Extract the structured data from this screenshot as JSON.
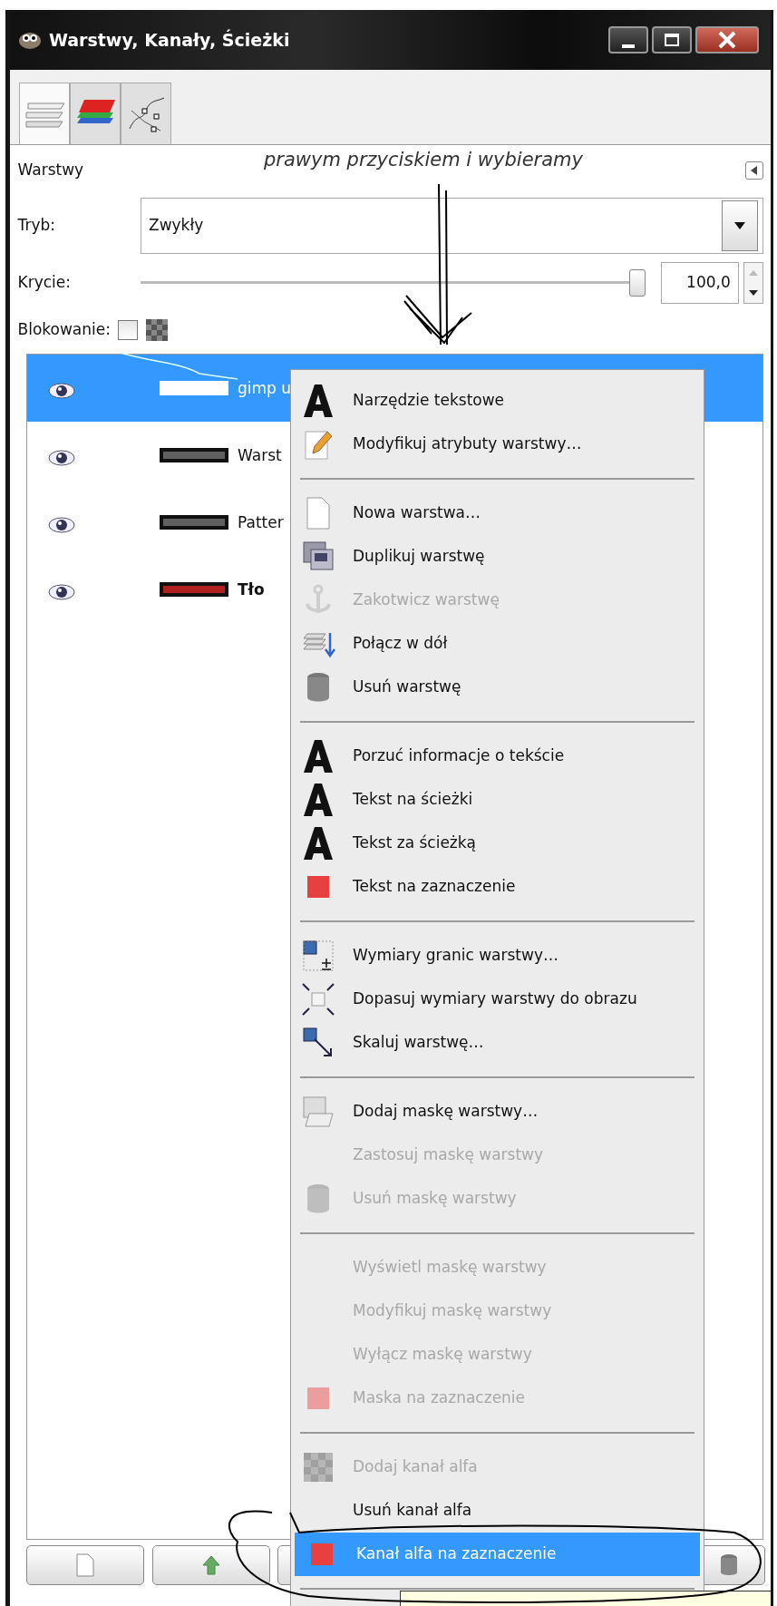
{
  "window": {
    "title": "Warstwy, Kanały, Ścieżki"
  },
  "tabs": [
    {
      "kind": "layers",
      "selected": true
    },
    {
      "kind": "channels",
      "selected": false
    },
    {
      "kind": "paths",
      "selected": false
    }
  ],
  "annotation": "prawym przyciskiem i wybieramy",
  "panel": {
    "title": "Warstwy",
    "mode": {
      "label": "Tryb:",
      "value": "Zwykły"
    },
    "opacity": {
      "label": "Krycie:",
      "level": 1,
      "reading": "100,0"
    },
    "lock": {
      "label": "Blokowanie:",
      "checked": false
    }
  },
  "layers": [
    {
      "name": "gimp u",
      "visible": true,
      "selected": true,
      "bold": false,
      "color": "#ffffff"
    },
    {
      "name": "Warst",
      "visible": true,
      "selected": false,
      "bold": false,
      "color": "#606060"
    },
    {
      "name": "Patter",
      "visible": true,
      "selected": false,
      "bold": false,
      "color": "#606060"
    },
    {
      "name": "Tło",
      "visible": true,
      "selected": false,
      "bold": true,
      "color": "#b02020"
    }
  ],
  "bottom_buttons": [
    {
      "kind": "new"
    },
    {
      "kind": "raise"
    },
    {
      "kind": "other"
    },
    {
      "kind": "delete"
    }
  ],
  "context_menu": {
    "items": [
      {
        "kind": "text-a",
        "label": "Narzędzie tekstowe",
        "disabled": false,
        "selected": false
      },
      {
        "kind": "pencil",
        "label": "Modyfikuj atrybuty warstwy…",
        "disabled": false,
        "selected": false
      },
      {
        "kind": "separator"
      },
      {
        "kind": "page",
        "label": "Nowa warstwa…",
        "disabled": false,
        "selected": false
      },
      {
        "kind": "duplicate",
        "label": "Duplikuj warstwę",
        "disabled": false,
        "selected": false
      },
      {
        "kind": "anchor",
        "label": "Zakotwicz warstwę",
        "disabled": true,
        "selected": false
      },
      {
        "kind": "merge",
        "label": "Połącz w dół",
        "disabled": false,
        "selected": false
      },
      {
        "kind": "trash",
        "label": "Usuń warstwę",
        "disabled": false,
        "selected": false
      },
      {
        "kind": "separator"
      },
      {
        "kind": "text-a",
        "label": "Porzuć informacje o tekście",
        "disabled": false,
        "selected": false
      },
      {
        "kind": "text-a",
        "label": "Tekst na ścieżki",
        "disabled": false,
        "selected": false
      },
      {
        "kind": "text-a",
        "label": "Tekst za ścieżką",
        "disabled": false,
        "selected": false
      },
      {
        "kind": "red-square",
        "label": "Tekst na zaznaczenie",
        "disabled": false,
        "selected": false
      },
      {
        "kind": "separator"
      },
      {
        "kind": "resize",
        "label": "Wymiary granic warstwy…",
        "disabled": false,
        "selected": false
      },
      {
        "kind": "fit",
        "label": "Dopasuj wymiary warstwy do obrazu",
        "disabled": false,
        "selected": false
      },
      {
        "kind": "scale",
        "label": "Skaluj warstwę…",
        "disabled": false,
        "selected": false
      },
      {
        "kind": "separator"
      },
      {
        "kind": "mask",
        "label": "Dodaj maskę warstwy…",
        "disabled": false,
        "selected": false
      },
      {
        "kind": "none",
        "label": "Zastosuj maskę warstwy",
        "disabled": true,
        "selected": false
      },
      {
        "kind": "trash",
        "label": "Usuń maskę warstwy",
        "disabled": true,
        "selected": false
      },
      {
        "kind": "separator"
      },
      {
        "kind": "none",
        "label": "Wyświetl maskę warstwy",
        "disabled": true,
        "selected": false
      },
      {
        "kind": "none",
        "label": "Modyfikuj maskę warstwy",
        "disabled": true,
        "selected": false
      },
      {
        "kind": "none",
        "label": "Wyłącz maskę warstwy",
        "disabled": true,
        "selected": false
      },
      {
        "kind": "red-square",
        "label": "Maska na zaznaczenie",
        "disabled": true,
        "selected": false
      },
      {
        "kind": "separator"
      },
      {
        "kind": "checker",
        "label": "Dodaj kanał alfa",
        "disabled": true,
        "selected": false
      },
      {
        "kind": "none",
        "label": "Usuń kanał alfa",
        "disabled": false,
        "selected": false
      },
      {
        "kind": "red-square",
        "label": "Kanał alfa na zaznaczenie",
        "disabled": false,
        "selected": true
      },
      {
        "kind": "separator"
      }
    ]
  },
  "tooltip": {
    "shown": true
  }
}
